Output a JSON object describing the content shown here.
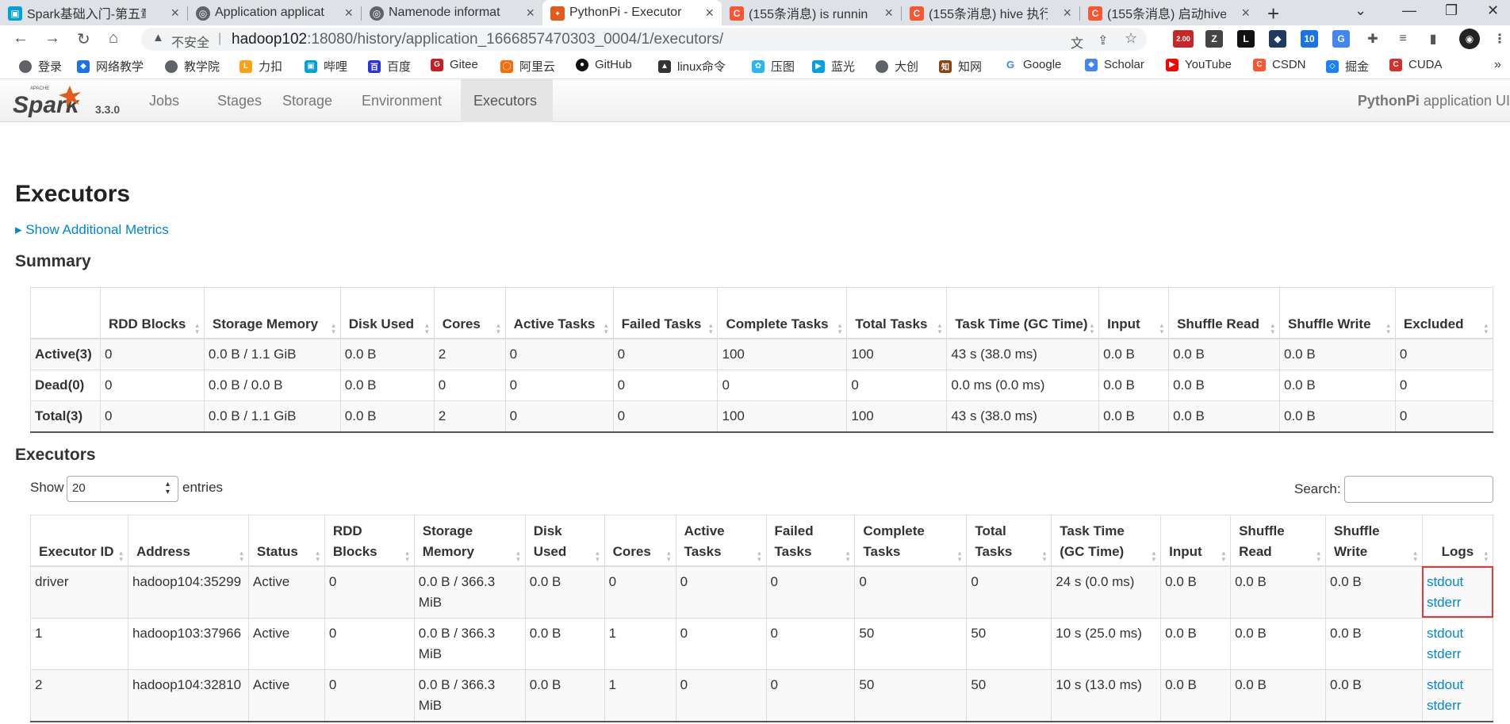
{
  "browser": {
    "tabs": [
      {
        "title": "Spark基础入门-第五章",
        "favicon": "bilibili-icon"
      },
      {
        "title": "Application applicat",
        "favicon": "globe-icon"
      },
      {
        "title": "Namenode informat",
        "favicon": "globe-icon"
      },
      {
        "title": "PythonPi - Executor",
        "favicon": "spark-icon",
        "active": true
      },
      {
        "title": "(155条消息) is runnin",
        "favicon": "csdn-icon"
      },
      {
        "title": "(155条消息) hive 执行",
        "favicon": "csdn-icon"
      },
      {
        "title": "(155条消息) 启动hive",
        "favicon": "csdn-icon"
      }
    ],
    "insecure_label": "不安全",
    "url_host": "hadoop102",
    "url_rest": ":18080/history/application_1666857470303_0004/1/executors/",
    "ext_badge": "2.00",
    "bookmarks": [
      "登录",
      "网络教学",
      "教学院",
      "力扣",
      "哔哩",
      "百度",
      "Gitee",
      "阿里云",
      "GitHub",
      "linux命令",
      "压图",
      "蓝光",
      "大创",
      "知网",
      "Google",
      "Scholar",
      "YouTube",
      "CSDN",
      "掘金",
      "CUDA"
    ]
  },
  "spark": {
    "logo_text": "Spark",
    "logo_small": "APACHE",
    "version": "3.3.0",
    "nav": [
      "Jobs",
      "Stages",
      "Storage",
      "Environment",
      "Executors"
    ],
    "app_name": "PythonPi",
    "app_suffix": "application UI"
  },
  "page": {
    "title": "Executors",
    "show_additional_metrics": "Show Additional Metrics",
    "summary_title": "Summary",
    "executors_title": "Executors",
    "show_label": "Show",
    "page_size": "20",
    "entries_label": "entries",
    "search_label": "Search:"
  },
  "summary": {
    "headers": [
      "",
      "RDD Blocks",
      "Storage Memory",
      "Disk Used",
      "Cores",
      "Active Tasks",
      "Failed Tasks",
      "Complete Tasks",
      "Total Tasks",
      "Task Time (GC Time)",
      "Input",
      "Shuffle Read",
      "Shuffle Write",
      "Excluded"
    ],
    "rows": [
      [
        "Active(3)",
        "0",
        "0.0 B / 1.1 GiB",
        "0.0 B",
        "2",
        "0",
        "0",
        "100",
        "100",
        "43 s (38.0 ms)",
        "0.0 B",
        "0.0 B",
        "0.0 B",
        "0"
      ],
      [
        "Dead(0)",
        "0",
        "0.0 B / 0.0 B",
        "0.0 B",
        "0",
        "0",
        "0",
        "0",
        "0",
        "0.0 ms (0.0 ms)",
        "0.0 B",
        "0.0 B",
        "0.0 B",
        "0"
      ],
      [
        "Total(3)",
        "0",
        "0.0 B / 1.1 GiB",
        "0.0 B",
        "2",
        "0",
        "0",
        "100",
        "100",
        "43 s (38.0 ms)",
        "0.0 B",
        "0.0 B",
        "0.0 B",
        "0"
      ]
    ]
  },
  "executors": {
    "headers": [
      "Executor ID",
      "Address",
      "Status",
      "RDD Blocks",
      "Storage Memory",
      "Disk Used",
      "Cores",
      "Active Tasks",
      "Failed Tasks",
      "Complete Tasks",
      "Total Tasks",
      "Task Time (GC Time)",
      "Input",
      "Shuffle Read",
      "Shuffle Write",
      "Logs"
    ],
    "rows": [
      [
        "driver",
        "hadoop104:35299",
        "Active",
        "0",
        "0.0 B / 366.3 MiB",
        "0.0 B",
        "0",
        "0",
        "0",
        "0",
        "0",
        "24 s (0.0 ms)",
        "0.0 B",
        "0.0 B",
        "0.0 B"
      ],
      [
        "1",
        "hadoop103:37966",
        "Active",
        "0",
        "0.0 B / 366.3 MiB",
        "0.0 B",
        "1",
        "0",
        "0",
        "50",
        "50",
        "10 s (25.0 ms)",
        "0.0 B",
        "0.0 B",
        "0.0 B"
      ],
      [
        "2",
        "hadoop104:32810",
        "Active",
        "0",
        "0.0 B / 366.3 MiB",
        "0.0 B",
        "1",
        "0",
        "0",
        "50",
        "50",
        "10 s (13.0 ms)",
        "0.0 B",
        "0.0 B",
        "0.0 B"
      ]
    ],
    "log_links": [
      "stdout",
      "stderr"
    ]
  },
  "colors": {
    "link": "#0088cc",
    "highlight": "#e53935"
  }
}
